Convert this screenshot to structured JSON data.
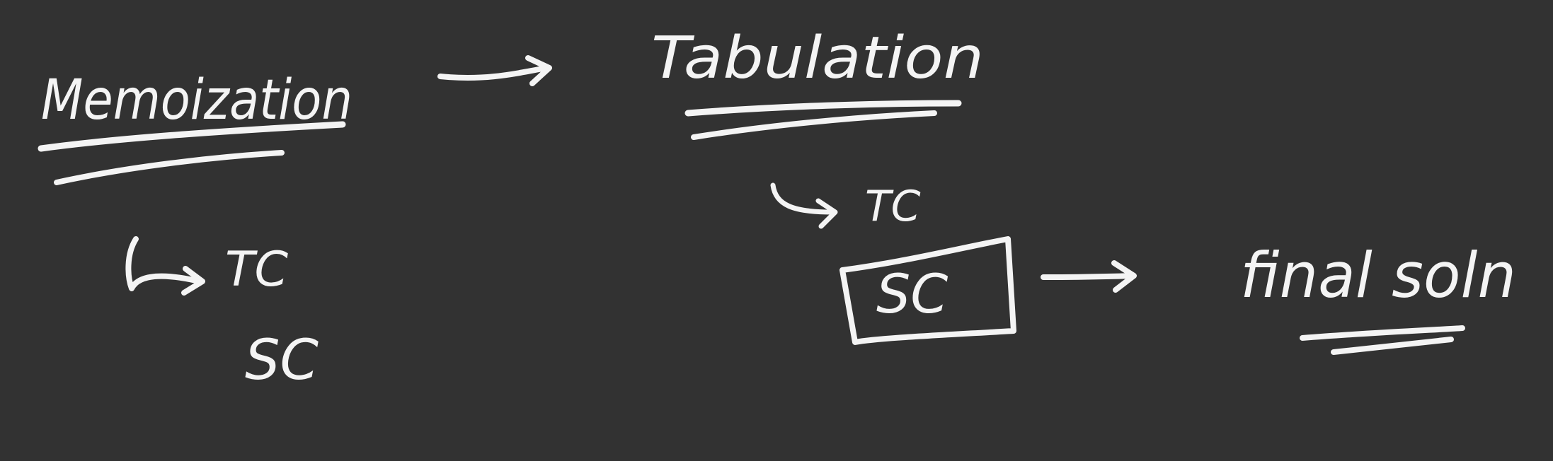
{
  "canvas": {
    "background": "#323232",
    "ink_color": "#f4f4f4"
  },
  "notes": {
    "memoization": {
      "title": "Memoization",
      "time_complexity": "TC",
      "space_complexity": "SC"
    },
    "tabulation": {
      "title": "Tabulation",
      "time_complexity": "TC",
      "space_complexity": "SC"
    },
    "result": {
      "label": "final soln"
    }
  }
}
